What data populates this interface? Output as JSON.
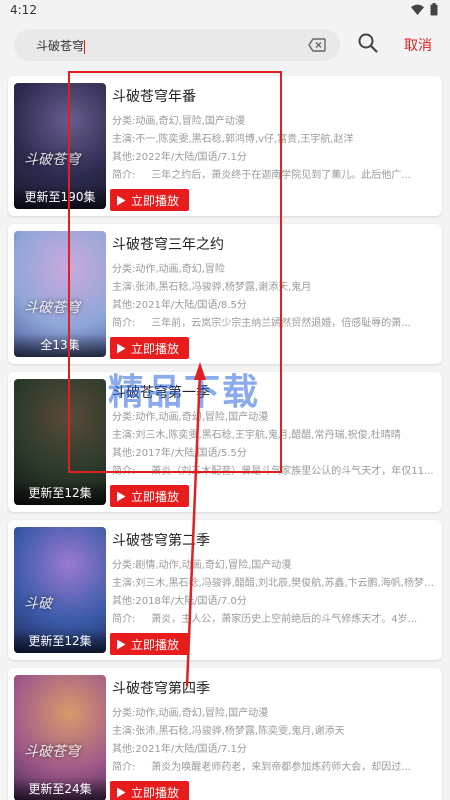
{
  "status_bar": {
    "time": "4:12"
  },
  "search": {
    "value": "斗破苍穹",
    "cancel_label": "取消"
  },
  "labels": {
    "category": "分类:",
    "cast": "主演:",
    "other": "其他:",
    "intro": "简介:",
    "play": "立即播放"
  },
  "results": [
    {
      "title": "斗破苍穹年番",
      "category": "动画,奇幻,冒险,国产动漫",
      "cast": "不一,陈奕雯,黑石稔,郭鸿博,v仔,富贵,王宇航,赵洋",
      "other": "2022年/大陆/国语/7.1分",
      "intro": "三年之约后，萧炎终于在迦南学院见到了薰儿。此后他广...",
      "episodes": "更新至190集",
      "poster_art": "斗破苍穹",
      "colors": [
        "#2b2a4e",
        "#6a5c8e",
        "#1a1a2e"
      ]
    },
    {
      "title": "斗破苍穹三年之约",
      "category": "动作,动画,奇幻,冒险",
      "cast": "张沛,黑石稔,冯骏骅,杨梦露,谢添天,鬼月",
      "other": "2021年/大陆/国语/8.5分",
      "intro": "三年前，云岚宗少宗主纳兰嫣然贸然退婚，倍感耻辱的萧...",
      "episodes": "全13集",
      "poster_art": "斗破苍穹",
      "colors": [
        "#8fa6d8",
        "#c9a9dd",
        "#4b5a9a"
      ]
    },
    {
      "title": "斗破苍穹第一季",
      "category": "动作,动画,奇幻,冒险,国产动漫",
      "cast": "刘三木,陈奕雯,黑石稔,王宇航,鬼月,醋醋,常丹瑞,祝俊,杜晴晴",
      "other": "2017年/大陆/国语/5.5分",
      "intro": "萧炎（刘三木配音）曾是斗气家族里公认的斗气天才，年仅11...",
      "episodes": "更新至12集",
      "poster_art": "",
      "colors": [
        "#2a3a2a",
        "#5a4a3a",
        "#151515"
      ]
    },
    {
      "title": "斗破苍穹第二季",
      "category": "剧情,动作,动画,奇幻,冒险,国产动漫",
      "cast": "刘三木,黑石稔,冯骏骅,醋醋,刘北辰,樊俊航,苏鑫,卞云鹏,海帆,杨梦露...",
      "other": "2018年/大陆/国语/7.0分",
      "intro": "萧炎，主人公，萧家历史上空前绝后的斗气修炼天才。4岁...",
      "episodes": "更新至12集",
      "poster_art": "斗破",
      "colors": [
        "#3a5aa8",
        "#9a7ad0",
        "#1e2a5a"
      ]
    },
    {
      "title": "斗破苍穹第四季",
      "category": "动作,动画,奇幻,冒险,国产动漫",
      "cast": "张沛,黑石稔,冯骏骅,杨梦露,陈奕雯,鬼月,谢添天",
      "other": "2021年/大陆/国语/7.1分",
      "intro": "萧炎为唤醒老师药老，来到帝都参加炼药师大会，却因过...",
      "episodes": "更新至24集",
      "poster_art": "斗破苍穹",
      "colors": [
        "#a05a8a",
        "#d89a6a",
        "#4a2a5a"
      ]
    }
  ],
  "watermark": "精品下载",
  "accent_color": "#e02020"
}
